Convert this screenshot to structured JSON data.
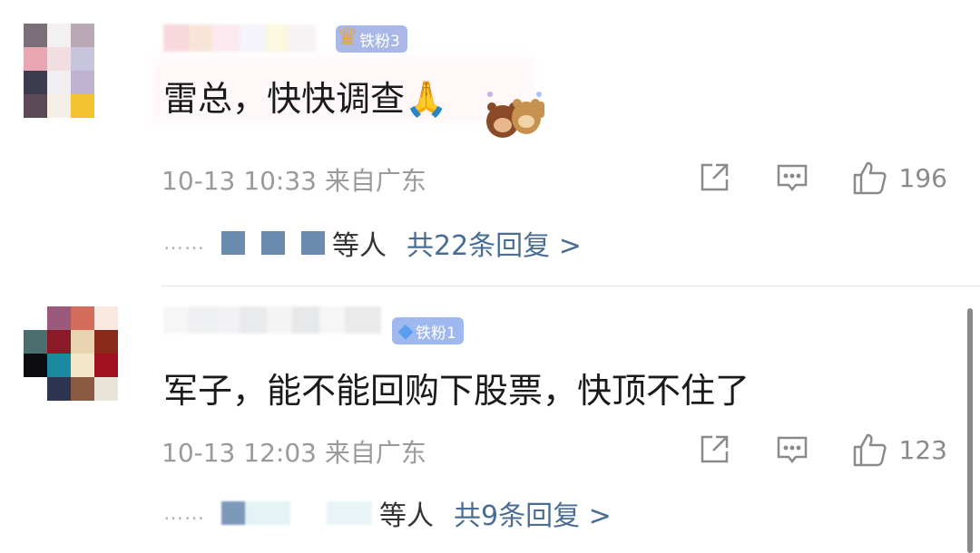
{
  "comments": [
    {
      "badge": "铁粉3",
      "badge_icon": "crown-icon",
      "text": "雷总，快快调查",
      "emoji": "🙏",
      "timestamp": "10-13 10:33",
      "location": "来自广东",
      "likes": "196",
      "reply_suffix": "等人",
      "reply_link": "共22条回复 >"
    },
    {
      "badge": "铁粉1",
      "badge_icon": "diamond-icon",
      "text": "军子，能不能回购下股票，快顶不住了",
      "emoji": "",
      "timestamp": "10-13 12:03",
      "location": "来自广东",
      "likes": "123",
      "reply_suffix": "等人",
      "reply_link": "共9条回复 >"
    }
  ],
  "icons": {
    "share": "share-icon",
    "comment": "comment-icon",
    "like": "thumbs-up-icon"
  },
  "colors": {
    "link": "#4a6d93",
    "meta": "#9a9a9a",
    "badge_gold": "#e8a640",
    "badge_blue": "#5a9ef0"
  },
  "more_dots": "……"
}
